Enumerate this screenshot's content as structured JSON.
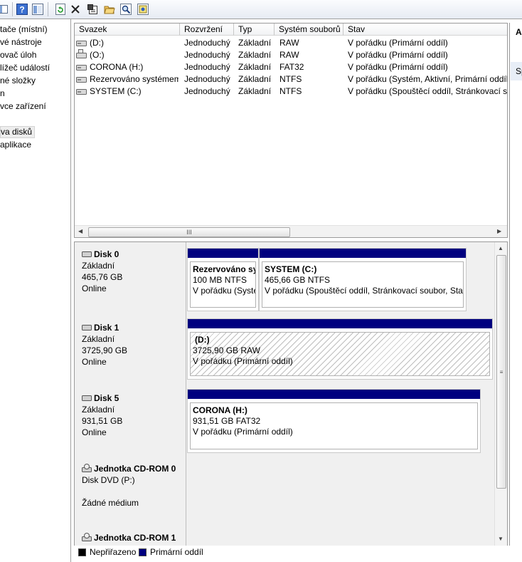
{
  "toolbar": {
    "buttons": [
      {
        "name": "view-pane-icon"
      },
      {
        "name": "help-icon"
      },
      {
        "name": "show-pane-icon"
      },
      {
        "name": "refresh-icon"
      },
      {
        "name": "delete-icon"
      },
      {
        "name": "properties-icon"
      },
      {
        "name": "open-folder-icon"
      },
      {
        "name": "search-icon"
      },
      {
        "name": "settings-icon"
      }
    ]
  },
  "nav": {
    "items": [
      {
        "label": "tače (místní)"
      },
      {
        "label": "vé nástroje"
      },
      {
        "label": "ovač úloh"
      },
      {
        "label": "lížeč událostí"
      },
      {
        "label": "né složky"
      },
      {
        "label": "n"
      },
      {
        "label": "vce zařízení"
      },
      {
        "label": ""
      },
      {
        "label": "va disků",
        "selected": true
      },
      {
        "label": "aplikace"
      }
    ]
  },
  "volumes": {
    "columns": [
      "Svazek",
      "Rozvržení",
      "Typ",
      "Systém souborů",
      "Stav"
    ],
    "rows": [
      {
        "name": "(D:)",
        "layout": "Jednoduchý",
        "type": "Základní",
        "fs": "RAW",
        "status": "V pořádku (Primární oddíl)"
      },
      {
        "name": "(O:)",
        "layout": "Jednoduchý",
        "type": "Základní",
        "fs": "RAW",
        "status": "V pořádku (Primární oddíl)"
      },
      {
        "name": "CORONA (H:)",
        "layout": "Jednoduchý",
        "type": "Základní",
        "fs": "FAT32",
        "status": "V pořádku (Primární oddíl)"
      },
      {
        "name": "Rezervováno systémem",
        "layout": "Jednoduchý",
        "type": "Základní",
        "fs": "NTFS",
        "status": "V pořádku (Systém, Aktivní, Primární oddíl)"
      },
      {
        "name": "SYSTEM (C:)",
        "layout": "Jednoduchý",
        "type": "Základní",
        "fs": "NTFS",
        "status": "V pořádku (Spouštěcí oddíl, Stránkovací so"
      }
    ],
    "hscroll_grip": "III"
  },
  "actions": {
    "title": "Al",
    "item": "Sp"
  },
  "disks": [
    {
      "name": "Disk 0",
      "type": "Základní",
      "size": "465,76 GB",
      "state": "Online",
      "partitions": [
        {
          "title": "Rezervováno sy",
          "size": "100 MB NTFS",
          "status": "V pořádku (Syste"
        },
        {
          "title": "SYSTEM  (C:)",
          "size": "465,66 GB NTFS",
          "status": "V pořádku (Spouštěcí oddíl, Stránkovací soubor, Stav"
        }
      ]
    },
    {
      "name": "Disk 1",
      "type": "Základní",
      "size": "3725,90 GB",
      "state": "Online",
      "partitions": [
        {
          "title": "(D:)",
          "size": "3725,90 GB RAW",
          "status": "V pořádku (Primární oddíl)"
        }
      ]
    },
    {
      "name": "Disk 5",
      "type": "Základní",
      "size": "931,51 GB",
      "state": "Online",
      "partitions": [
        {
          "title": "CORONA  (H:)",
          "size": "931,51 GB FAT32",
          "status": "V pořádku (Primární oddíl)"
        }
      ]
    },
    {
      "name": "Jednotka CD-ROM 0",
      "type": "Disk DVD (P:)",
      "size": "",
      "state": "Žádné médium"
    },
    {
      "name": "Jednotka CD-ROM 1"
    }
  ],
  "legend": {
    "items": [
      {
        "label": "Nepřiřazeno",
        "color": "#000000"
      },
      {
        "label": "Primární oddíl",
        "color": "#00007f"
      }
    ]
  },
  "vscroll_grip": "≡"
}
